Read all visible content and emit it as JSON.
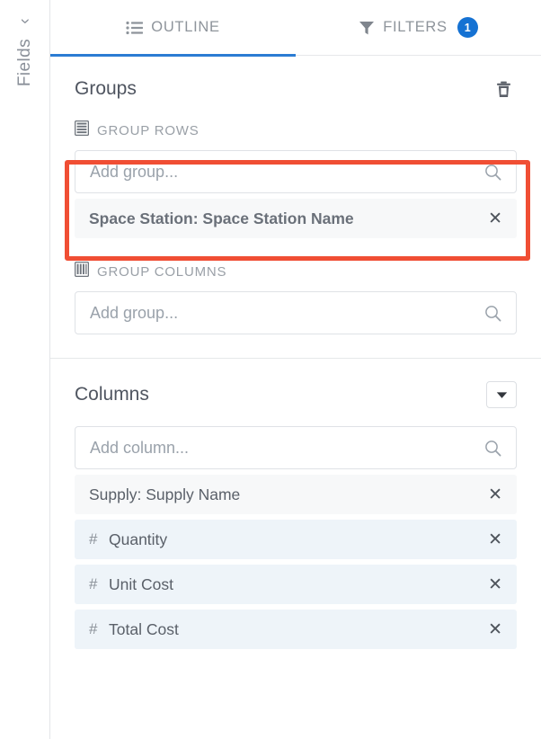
{
  "rail": {
    "label": "Fields",
    "chevron_icon": "chevron-right-icon"
  },
  "tabs": [
    {
      "label": "OUTLINE",
      "icon": "list-outline-icon",
      "active": true,
      "badge": null
    },
    {
      "label": "FILTERS",
      "icon": "funnel-filter-icon",
      "active": false,
      "badge": "1"
    }
  ],
  "groups": {
    "title": "Groups",
    "delete_icon": "trash-icon",
    "group_rows": {
      "label": "GROUP ROWS",
      "icon": "rows-icon",
      "input": {
        "placeholder": "Add group...",
        "value": "",
        "search_icon": "search-icon"
      },
      "chips": [
        {
          "text": "Space Station: Space Station Name",
          "type": "text",
          "remove_icon": "close-icon"
        }
      ]
    },
    "group_columns": {
      "label": "GROUP COLUMNS",
      "icon": "columns-icon",
      "input": {
        "placeholder": "Add group...",
        "value": "",
        "search_icon": "search-icon"
      },
      "chips": []
    }
  },
  "columns": {
    "title": "Columns",
    "menu_icon": "caret-down-icon",
    "input": {
      "placeholder": "Add column...",
      "value": "",
      "search_icon": "search-icon"
    },
    "chips": [
      {
        "text": "Supply: Supply Name",
        "type": "text",
        "hash": "",
        "remove_icon": "close-icon"
      },
      {
        "text": "Quantity",
        "type": "numeric",
        "hash": "#",
        "remove_icon": "close-icon"
      },
      {
        "text": "Unit Cost",
        "type": "numeric",
        "hash": "#",
        "remove_icon": "close-icon"
      },
      {
        "text": "Total Cost",
        "type": "numeric",
        "hash": "#",
        "remove_icon": "close-icon"
      }
    ]
  },
  "annotation": {
    "name": "group-rows-highlight",
    "color": "#f04e34"
  },
  "colors": {
    "accent_blue": "#2b7cd3",
    "badge_blue": "#1572d3",
    "highlight_red": "#f04e34",
    "numeric_chip_bg": "#eef4f9",
    "text_chip_bg": "#f7f8f9"
  }
}
